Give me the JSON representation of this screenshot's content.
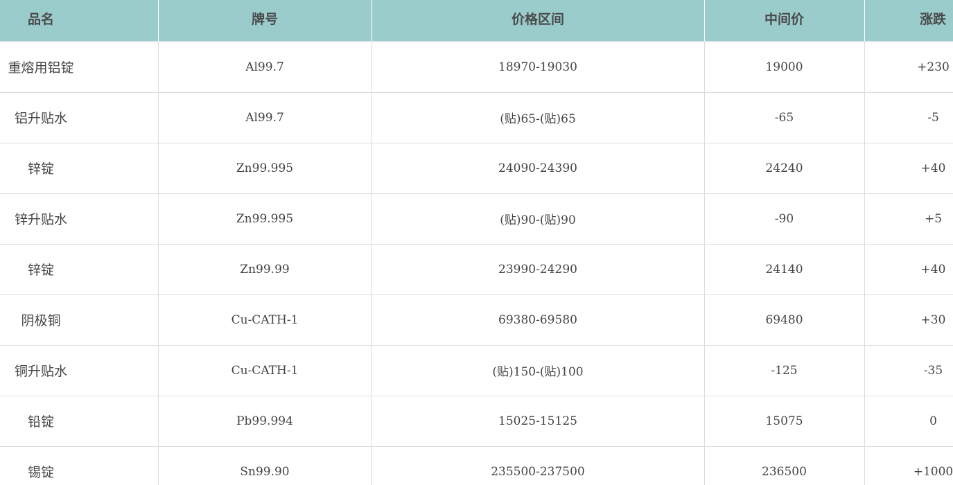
{
  "table": {
    "headers": {
      "name": "品名",
      "grade": "牌号",
      "range": "价格区间",
      "mid": "中间价",
      "change": "涨跌"
    },
    "rows": [
      {
        "name": "重熔用铝锭",
        "grade": "Al99.7",
        "range": "18970-19030",
        "mid": "19000",
        "change": "+230"
      },
      {
        "name": "铝升贴水",
        "grade": "Al99.7",
        "range": "(贴)65-(贴)65",
        "mid": "-65",
        "change": "-5"
      },
      {
        "name": "锌锭",
        "grade": "Zn99.995",
        "range": "24090-24390",
        "mid": "24240",
        "change": "+40"
      },
      {
        "name": "锌升贴水",
        "grade": "Zn99.995",
        "range": "(贴)90-(贴)90",
        "mid": "-90",
        "change": "+5"
      },
      {
        "name": "锌锭",
        "grade": "Zn99.99",
        "range": "23990-24290",
        "mid": "24140",
        "change": "+40"
      },
      {
        "name": "阴极铜",
        "grade": "Cu-CATH-1",
        "range": "69380-69580",
        "mid": "69480",
        "change": "+30"
      },
      {
        "name": "铜升贴水",
        "grade": "Cu-CATH-1",
        "range": "(贴)150-(贴)100",
        "mid": "-125",
        "change": "-35"
      },
      {
        "name": "铅锭",
        "grade": "Pb99.994",
        "range": "15025-15125",
        "mid": "15075",
        "change": "0"
      },
      {
        "name": "锡锭",
        "grade": "Sn99.90",
        "range": "235500-237500",
        "mid": "236500",
        "change": "+1000"
      }
    ]
  }
}
